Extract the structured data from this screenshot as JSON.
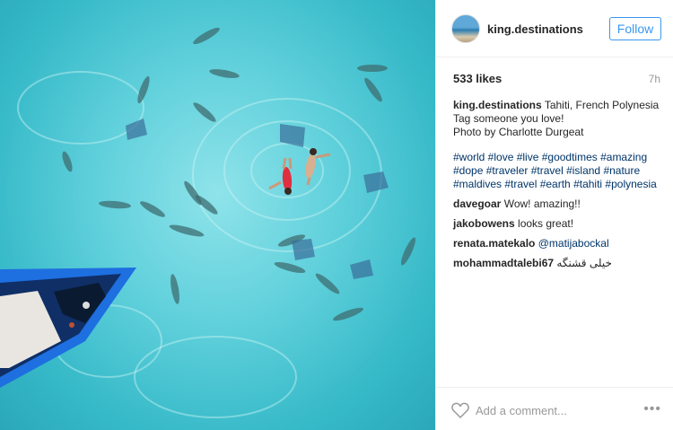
{
  "post": {
    "username": "king.destinations",
    "follow_label": "Follow",
    "likes": "533 likes",
    "time_ago": "7h",
    "caption": {
      "username": "king.destinations",
      "location": "Tahiti, French Polynesia",
      "line2": "Tag someone you love!",
      "line3": "Photo by Charlotte Durgeat"
    },
    "hashtags": {
      "line1": "#world #love #live #goodtimes #amazing",
      "line2": "#dope #traveler #travel #island #nature",
      "line3": "#maldives #travel #earth #tahiti #polynesia"
    },
    "comments": [
      {
        "user": "davegoar",
        "text": "Wow! amazing!!"
      },
      {
        "user": "jakobowens",
        "text": "looks great!"
      },
      {
        "user": "renata.matekalo",
        "text": "@matijabockal"
      },
      {
        "user": "mohammadtalebi67",
        "text": "خیلی قشنگه"
      }
    ],
    "add_comment_placeholder": "Add a comment...",
    "more_glyph": "•••"
  },
  "icons": {
    "like": "heart-icon",
    "more": "more-options-icon",
    "avatar": "avatar"
  },
  "colors": {
    "follow_blue": "#3897f0",
    "hashtag_blue": "#003569",
    "water": "#5fd0db",
    "boat": "#1e6fe0"
  }
}
